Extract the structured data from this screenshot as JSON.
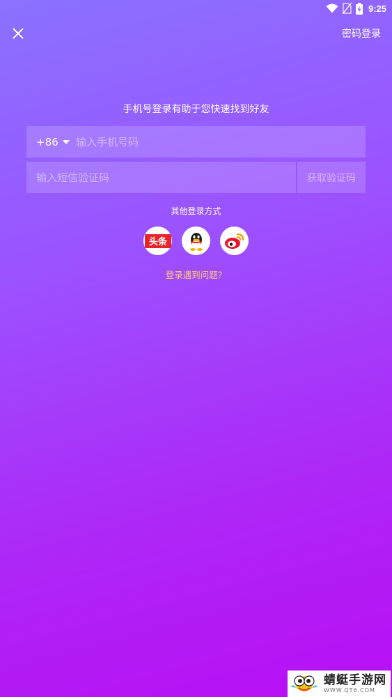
{
  "status_bar": {
    "time": "9:25",
    "icons": [
      "wifi-icon",
      "no-sim-icon",
      "battery-charging-icon"
    ]
  },
  "top_bar": {
    "close_icon": "close-icon",
    "password_login_label": "密码登录"
  },
  "hint": "手机号登录有助于您快速找到好友",
  "phone": {
    "country_code": "+86",
    "placeholder": "输入手机号码",
    "value": ""
  },
  "sms": {
    "placeholder": "输入短信验证码",
    "value": "",
    "get_code_label": "获取验证码"
  },
  "other_login": {
    "label": "其他登录方式",
    "providers": [
      {
        "icon": "toutiao-icon",
        "text": "头条",
        "color": "#e8242b"
      },
      {
        "icon": "qq-icon"
      },
      {
        "icon": "weibo-icon",
        "color": "#e6162d"
      }
    ]
  },
  "trouble_link": "登录遇到问题？",
  "colors": {
    "gradient_start": "#8a72ff",
    "gradient_end": "#b80ef3",
    "link": "#ffc870"
  },
  "watermark": {
    "title": "蜻蜓手游网",
    "url": "WWW.QT6.COM"
  }
}
